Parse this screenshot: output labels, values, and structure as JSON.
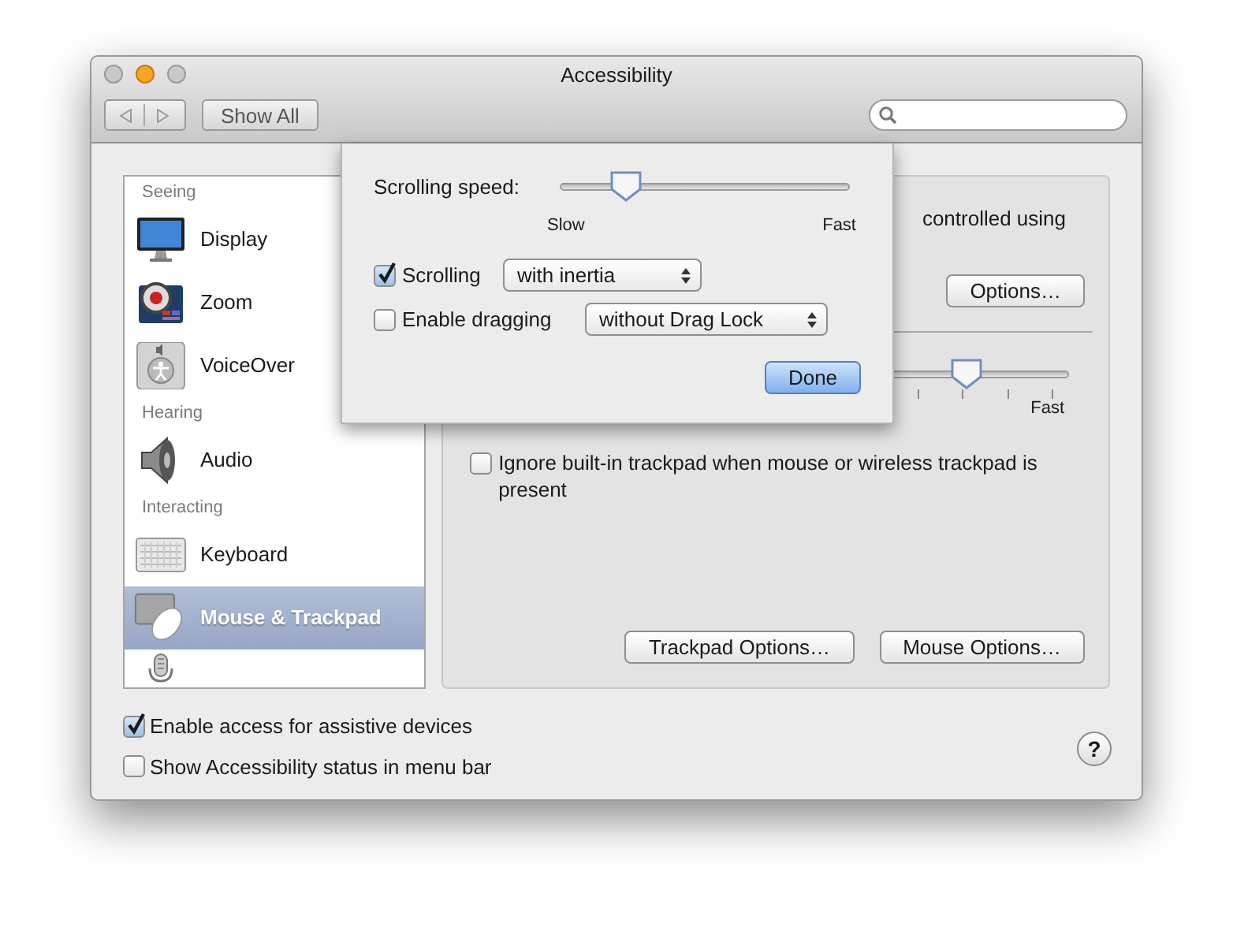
{
  "window": {
    "title": "Accessibility"
  },
  "toolbar": {
    "show_all": "Show All"
  },
  "sidebar": {
    "groups": [
      {
        "label": "Seeing",
        "items": [
          {
            "kind": "display",
            "label": "Display",
            "selected": false
          },
          {
            "kind": "zoom",
            "label": "Zoom",
            "selected": false
          },
          {
            "kind": "voiceover",
            "label": "VoiceOver",
            "selected": false
          }
        ]
      },
      {
        "label": "Hearing",
        "items": [
          {
            "kind": "audio",
            "label": "Audio",
            "selected": false
          }
        ]
      },
      {
        "label": "Interacting",
        "items": [
          {
            "kind": "keyboard",
            "label": "Keyboard",
            "selected": false
          },
          {
            "kind": "mouse",
            "label": "Mouse & Trackpad",
            "selected": true
          },
          {
            "kind": "speakable",
            "selected": false
          }
        ]
      }
    ]
  },
  "panel": {
    "description": "controlled using",
    "options_button": "Options…",
    "double_click_slider": {
      "level": 0.76,
      "max_label": "Fast"
    },
    "ignore_trackpad": {
      "label": "Ignore built-in trackpad when mouse or wireless trackpad is present",
      "checked": false
    },
    "buttons": [
      "Trackpad Options…",
      "Mouse Options…"
    ]
  },
  "sheet": {
    "speed_label": "Scrolling speed:",
    "speed_slider": {
      "level": 0.19,
      "min_label": "Slow",
      "max_label": "Fast"
    },
    "options": [
      {
        "label": "Scrolling",
        "checked": true,
        "value": "with inertia"
      },
      {
        "label": "Enable dragging",
        "checked": false,
        "value": "without Drag Lock"
      }
    ],
    "done": "Done"
  },
  "bottom": {
    "checkboxes": [
      {
        "label": "Enable access for assistive devices",
        "checked": true
      },
      {
        "label": "Show Accessibility status in menu bar",
        "checked": false
      }
    ],
    "help": "?"
  }
}
